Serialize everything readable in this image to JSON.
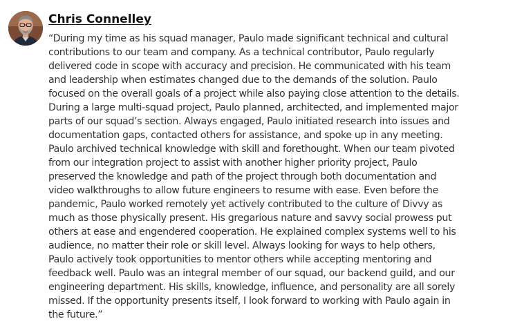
{
  "recommendation": {
    "author": {
      "name": "Chris Connelley",
      "avatar_icon": "person-photo-icon"
    },
    "quote_lines": [
      "“During my time as his squad manager, Paulo made significant technical and cultural",
      "contributions to our team and company. As a technical contributor, Paulo regularly",
      "delivered code in scope with accuracy and precision. He communicated with his team",
      "and leadership when estimates changed due to the demands of the solution. Paulo",
      "focused on the overall goals of a project while also paying close attention to the details.",
      "During a large multi-squad project, Paulo planned, architected, and implemented major",
      "parts of our squad’s section. Always engaged, Paulo initiated research into issues and",
      "documentation gaps, contacted others for assistance, and spoke up in any meeting.",
      "Paulo archived technical knowledge with skill and forethought. When our team pivoted",
      "from our integration project to assist with another higher priority project, Paulo",
      "preserved the knowledge and path of the project through both documentation and",
      "video walkthroughs to allow future engineers to resume with ease. Even before the",
      "pandemic, Paulo worked remotely yet actively contributed to the culture of Divvy as",
      "much as those physically present. His gregarious nature and savvy social prowess put",
      "others at ease and engendered cooperation. He explained complex systems well to his",
      "audience, no matter their role or skill level. Always looking for ways to help others,",
      "Paulo actively took opportunities to mentor others while accepting mentoring and",
      "feedback well. Paulo was an integral member of our squad, our backend guild, and our",
      "engineering department. His skills, knowledge, influence, and personality are all sorely",
      "missed. If the opportunity presents itself, I look forward to working with Paulo again in",
      "the future.”"
    ]
  }
}
